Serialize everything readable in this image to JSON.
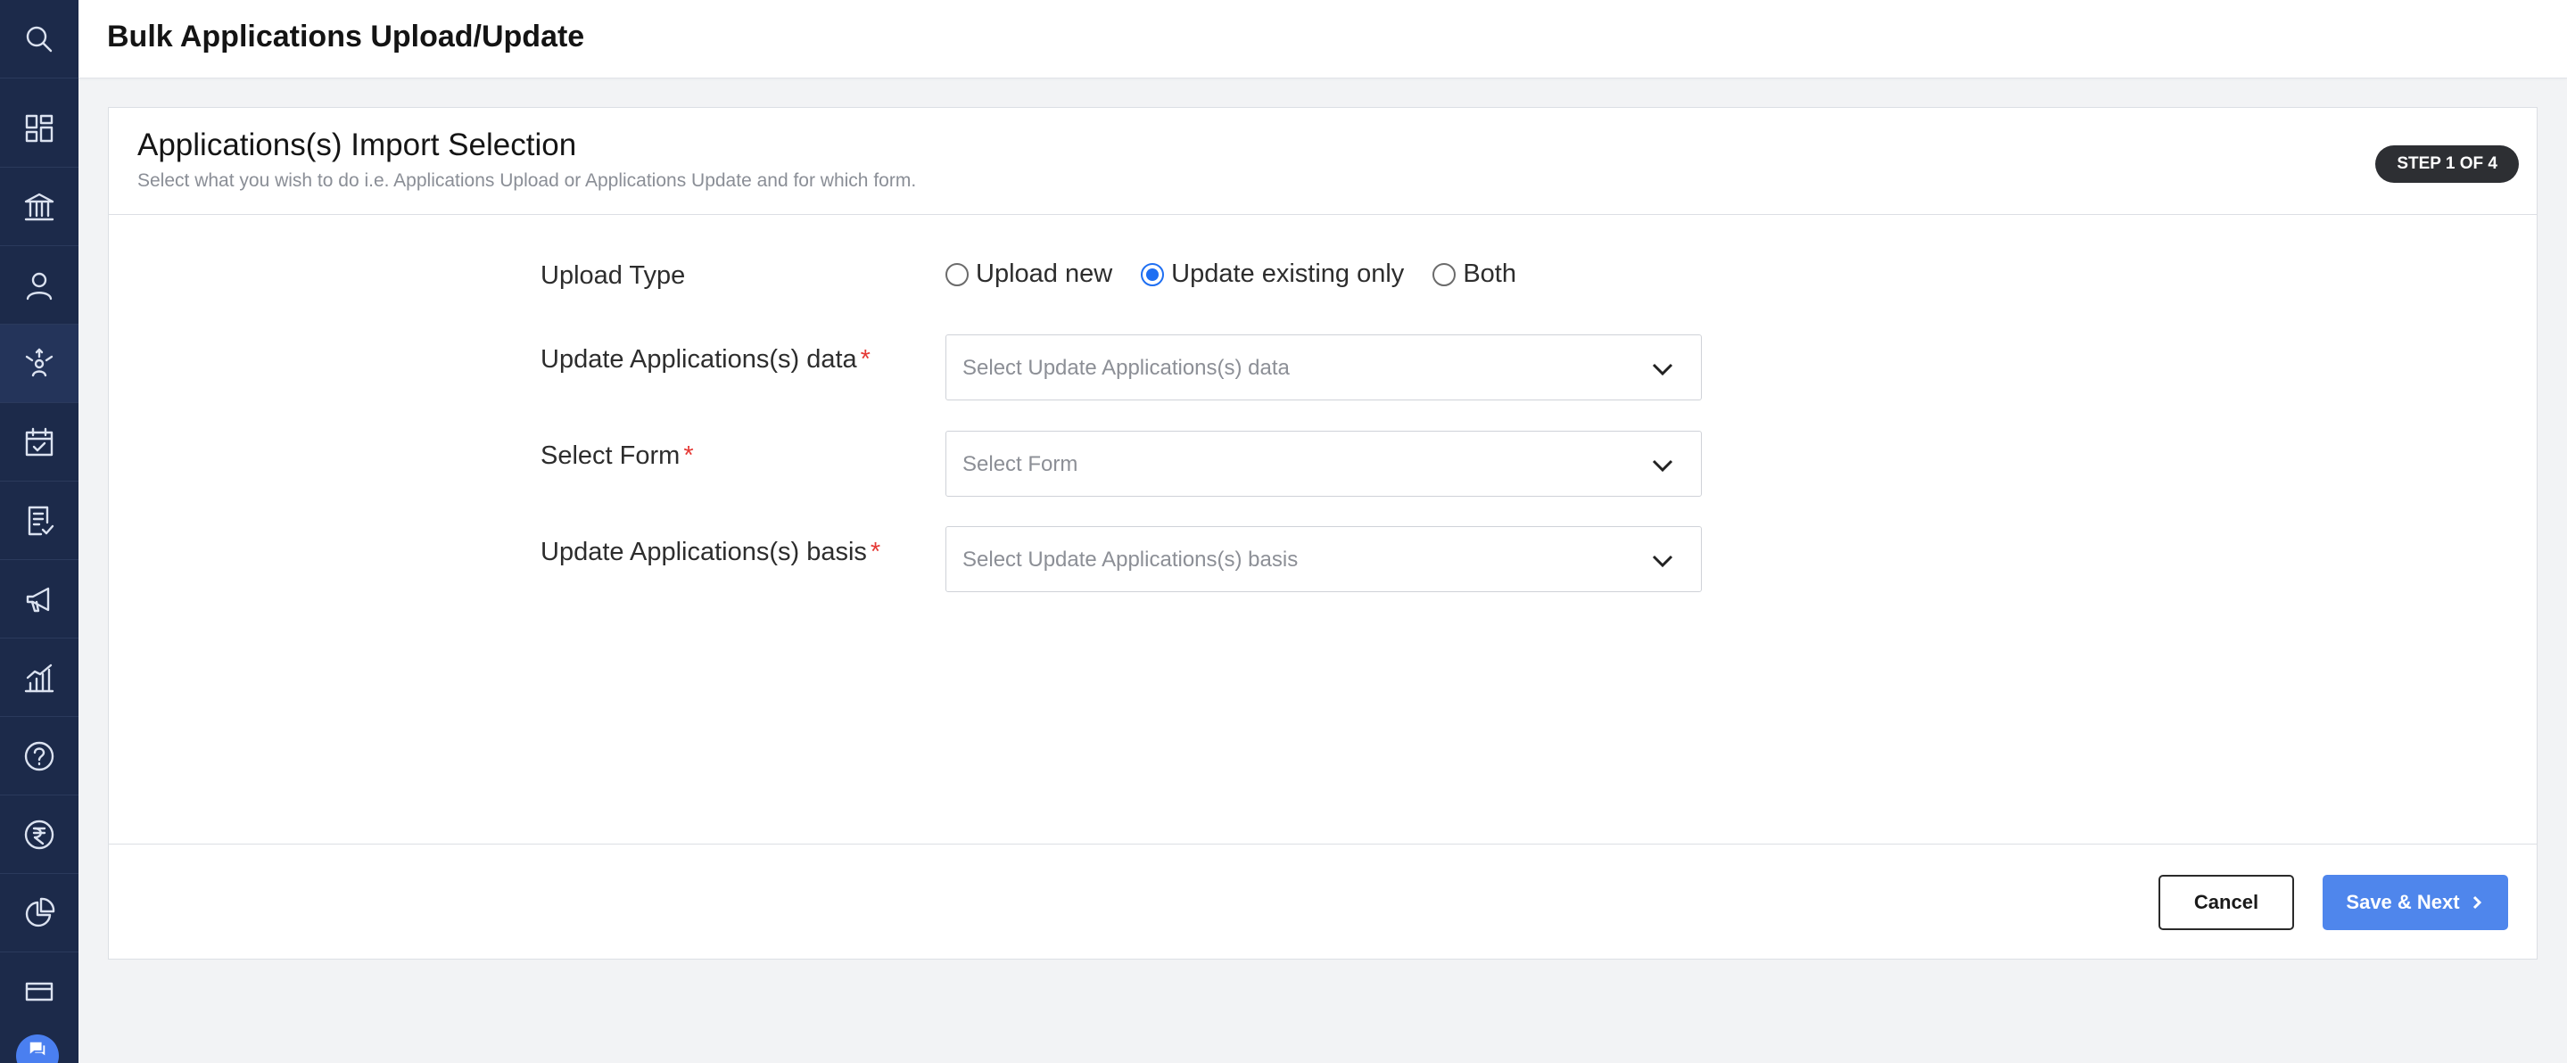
{
  "sidebar": {
    "items": [
      {
        "icon": "search-icon"
      },
      {
        "icon": "dashboard-icon"
      },
      {
        "icon": "institution-icon"
      },
      {
        "icon": "user-icon"
      },
      {
        "icon": "lead-network-icon"
      },
      {
        "icon": "calendar-check-icon"
      },
      {
        "icon": "checklist-icon"
      },
      {
        "icon": "megaphone-icon"
      },
      {
        "icon": "analytics-icon"
      },
      {
        "icon": "help-icon"
      },
      {
        "icon": "rupee-icon"
      },
      {
        "icon": "pie-chart-icon"
      },
      {
        "icon": "card-icon"
      }
    ],
    "chat_icon": "chat-icon"
  },
  "header": {
    "title": "Bulk Applications Upload/Update"
  },
  "card": {
    "title": "Applications(s) Import Selection",
    "subtitle": "Select what you wish to do i.e. Applications Upload or Applications Update and for which form.",
    "step_badge": "STEP 1 OF 4"
  },
  "form": {
    "upload_type": {
      "label": "Upload Type",
      "options": [
        "Upload new",
        "Update existing only",
        "Both"
      ],
      "selected": "Update existing only"
    },
    "update_data": {
      "label": "Update Applications(s) data",
      "required_mark": "*",
      "placeholder": "Select Update Applications(s) data"
    },
    "select_form": {
      "label": "Select Form",
      "required_mark": "*",
      "placeholder": "Select Form"
    },
    "update_basis": {
      "label": "Update Applications(s) basis",
      "required_mark": "*",
      "placeholder": "Select Update Applications(s) basis"
    }
  },
  "footer": {
    "cancel_label": "Cancel",
    "next_label": "Save & Next"
  },
  "colors": {
    "sidebar_bg": "#1c2a4a",
    "accent": "#4f86ec",
    "radio_checked": "#1f6ff2",
    "required": "#e53935",
    "badge_bg": "#2d2f33"
  }
}
